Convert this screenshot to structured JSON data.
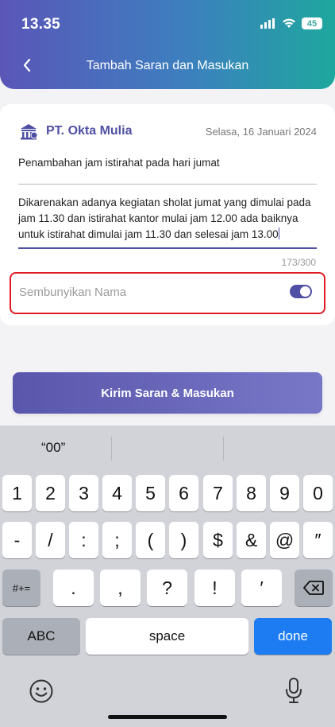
{
  "status": {
    "time": "13.35",
    "battery": "45"
  },
  "header": {
    "title": "Tambah Saran dan Masukan"
  },
  "company": {
    "name": "PT. Okta Mulia",
    "date": "Selasa, 16 Januari 2024"
  },
  "form": {
    "subject": "Penambahan jam istirahat pada hari jumat",
    "message": "Dikarenakan adanya kegiatan sholat jumat yang dimulai pada jam 11.30 dan istirahat kantor mulai jam 12.00 ada baiknya untuk istirahat dimulai jam 11.30 dan selesai jam 13.00",
    "counter": "173/300",
    "hide_name_label": "Sembunyikan Nama",
    "hide_name_enabled": true,
    "submit_label": "Kirim Saran & Masukan"
  },
  "keyboard": {
    "suggestions": [
      "“00”",
      "",
      ""
    ],
    "row1": [
      "1",
      "2",
      "3",
      "4",
      "5",
      "6",
      "7",
      "8",
      "9",
      "0"
    ],
    "row2": [
      "-",
      "/",
      ":",
      ";",
      "(",
      ")",
      "$",
      "&",
      "@",
      "″"
    ],
    "row3_left": "#+=",
    "row3": [
      ".",
      ",",
      "?",
      "!",
      "′"
    ],
    "abc": "ABC",
    "space": "space",
    "done": "done"
  },
  "colors": {
    "accent": "#4f4fa3",
    "highlight_border": "#e01b24",
    "done_key": "#1d7cf2"
  }
}
